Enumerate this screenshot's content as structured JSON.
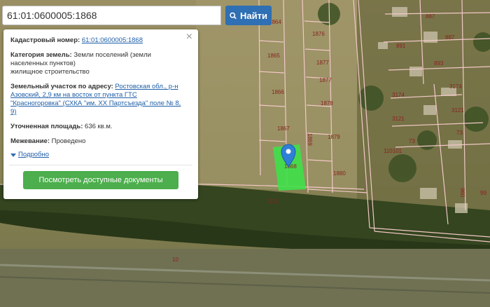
{
  "search": {
    "value": "61:01:0600005:1868",
    "button_label": "Найти"
  },
  "popup": {
    "cadastral_label": "Кадастровый номер:",
    "cadastral_value": "61:01:0600005:1868",
    "category_label": "Категория земель:",
    "category_value_1": "Земли поселений (земли",
    "category_value_2": "населенных пунктов)",
    "category_value_3": "жилищное строительство",
    "address_label": "Земельный участок по адресу:",
    "address_1": "Ростовская обл., р-н",
    "address_2": "Азовский, 2,9 км на восток от пункта ГТС",
    "address_3": "\"Красногоровка\" (СХКА \"им. XX Партсъезда\" поле № 8,",
    "address_4": "9)",
    "area_label": "Уточненная площадь:",
    "area_value": "636 кв.м.",
    "survey_label": "Межевание:",
    "survey_value": "Проведено",
    "details_link": "Подробно",
    "docs_button": "Посмотреть доступные документы",
    "close_glyph": "×"
  },
  "map": {
    "parcel_labels": [
      "1865",
      "1866",
      "1867",
      "1869",
      "1868",
      "1912",
      "1876",
      "1877",
      "1877",
      "1878",
      "1879",
      "1880",
      "887",
      "887",
      "891",
      "893",
      "3174",
      "3174",
      "3121",
      "3121",
      "73",
      "73",
      "110101",
      "960",
      "99",
      "10",
      "1864"
    ],
    "colors": {
      "selected_parcel": "#3fe04a",
      "boundary": "#f2c8c8",
      "marker": "#2f7fd6"
    }
  }
}
